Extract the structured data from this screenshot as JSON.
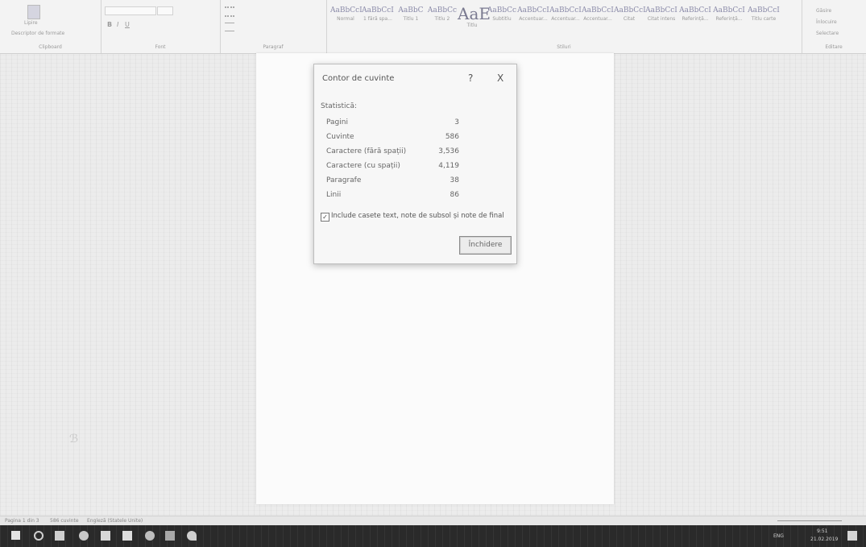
{
  "ribbon": {
    "clipboard": {
      "paste": "Lipire",
      "format_painter": "Descriptor de formate",
      "group_label": "Clipboard"
    },
    "font": {
      "group_label": "Font"
    },
    "paragraph": {
      "group_label": "Paragraf"
    },
    "styles": {
      "group_label": "Stiluri",
      "items": [
        {
          "sample": "AaBbCcI",
          "name": "Normal"
        },
        {
          "sample": "AaBbCcI",
          "name": "1 fără spa..."
        },
        {
          "sample": "AaBbC",
          "name": "Titlu 1"
        },
        {
          "sample": "AaBbCc",
          "name": "Titlu 2"
        },
        {
          "sample": "AaE",
          "name": "Titlu"
        },
        {
          "sample": "AaBbCc",
          "name": "Subtitlu"
        },
        {
          "sample": "AaBbCcI",
          "name": "Accentuar..."
        },
        {
          "sample": "AaBbCcI",
          "name": "Accentuar..."
        },
        {
          "sample": "AaBbCcI",
          "name": "Accentuar..."
        },
        {
          "sample": "AaBbCcI",
          "name": "Citat"
        },
        {
          "sample": "AaBbCcI",
          "name": "Citat intens"
        },
        {
          "sample": "AaBbCcI",
          "name": "Referință..."
        },
        {
          "sample": "AaBbCcI",
          "name": "Referință..."
        },
        {
          "sample": "AaBbCcI",
          "name": "Titlu carte"
        }
      ]
    },
    "editing": {
      "find": "Găsire",
      "replace": "Înlocuire",
      "select": "Selectare",
      "group_label": "Editare"
    }
  },
  "dialog": {
    "title": "Contor de cuvinte",
    "help": "?",
    "close": "X",
    "section": "Statistică:",
    "stats": [
      {
        "label": "Pagini",
        "value": "3"
      },
      {
        "label": "Cuvinte",
        "value": "586"
      },
      {
        "label": "Caractere (fără spații)",
        "value": "3,536"
      },
      {
        "label": "Caractere (cu spații)",
        "value": "4,119"
      },
      {
        "label": "Paragrafe",
        "value": "38"
      },
      {
        "label": "Linii",
        "value": "86"
      }
    ],
    "checkbox_label": "Include casete text, note de subsol și note de final",
    "checkbox_checked": true,
    "close_button": "Închidere"
  },
  "statusbar": {
    "page": "Pagina 1 din 3",
    "words": "586 cuvinte",
    "language": "Engleză (Statele Unite)"
  },
  "taskbar": {
    "time": "9:51",
    "date": "21.02.2019",
    "lang": "ENG"
  }
}
